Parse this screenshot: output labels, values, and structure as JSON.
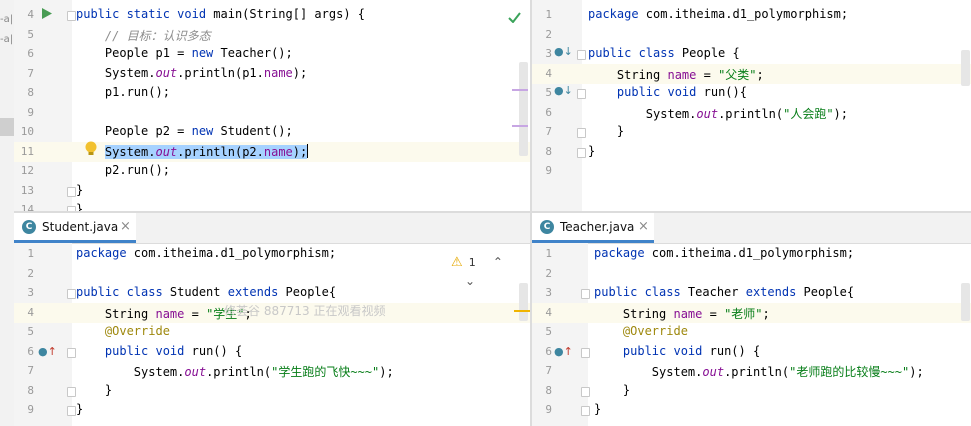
{
  "colors": {
    "keyword": "#0033b3",
    "string": "#067d17",
    "field": "#871094",
    "comment": "#8c8c8c",
    "annotation": "#9e880d",
    "selection": "#a6d2ff",
    "tab_underline": "#4083c9"
  },
  "left_strip": {
    "frag1": "-a|",
    "frag2": "-a|"
  },
  "top_left": {
    "lines": [
      {
        "n": "4",
        "html": "<span class='kw'>public static void</span> main(String[] args) {"
      },
      {
        "n": "5",
        "html": "    <span class='cmt'>// 目标：认识多态</span>"
      },
      {
        "n": "6",
        "html": "    People p1 = <span class='kw'>new</span> Teacher();"
      },
      {
        "n": "7",
        "html": "    System.<span class='it'>out</span>.println(p1.<span class='fld'>name</span>);"
      },
      {
        "n": "8",
        "html": "    p1.run();"
      },
      {
        "n": "9",
        "html": ""
      },
      {
        "n": "10",
        "html": "    People p2 = <span class='kw'>new</span> Student();"
      },
      {
        "n": "11",
        "html": "    <span class='selbg'>System.<span class='it'>out</span>.println(p2.<span class='fld'>name</span>);</span><span class='caret'></span>"
      },
      {
        "n": "12",
        "html": "    p2.run();"
      },
      {
        "n": "13",
        "html": "}"
      },
      {
        "n": "14",
        "html": "}"
      }
    ]
  },
  "top_right": {
    "lines": [
      {
        "n": "1",
        "html": "<span class='kw'>package</span> com.itheima.d1_polymorphism;"
      },
      {
        "n": "2",
        "html": ""
      },
      {
        "n": "3",
        "html": "<span class='kw'>public class</span> People {"
      },
      {
        "n": "4",
        "html": "    String <span class='fld'>name</span> = <span class='str'>\"父类\"</span>;"
      },
      {
        "n": "5",
        "html": "    <span class='kw'>public void</span> run(){"
      },
      {
        "n": "6",
        "html": "        System.<span class='it'>out</span>.println(<span class='str'>\"人会跑\"</span>);"
      },
      {
        "n": "7",
        "html": "    }"
      },
      {
        "n": "8",
        "html": "}"
      },
      {
        "n": "9",
        "html": ""
      }
    ]
  },
  "bottom_left": {
    "tab": {
      "icon": "C",
      "label": "Student.java",
      "close": "×"
    },
    "warnings": {
      "icon": "⚠",
      "count": "1",
      "up": "⌃",
      "down": "⌄"
    },
    "watermark": "修荟谷 887713 正在观看视频",
    "lines": [
      {
        "n": "1",
        "html": "<span class='kw'>package</span> com.itheima.d1_polymorphism;"
      },
      {
        "n": "2",
        "html": ""
      },
      {
        "n": "3",
        "html": "<span class='kw'>public class</span> Student <span class='kw'>extends</span> People{"
      },
      {
        "n": "4",
        "html": "    String <span class='fld'>name</span> = <span class='str'>\"学生\"</span>;"
      },
      {
        "n": "5",
        "html": "    <span class='ann'>@Override</span>"
      },
      {
        "n": "6",
        "html": "    <span class='kw'>public void</span> run() {"
      },
      {
        "n": "7",
        "html": "        System.<span class='it'>out</span>.println(<span class='str'>\"学生跑的飞快~~~\"</span>);"
      },
      {
        "n": "8",
        "html": "    }"
      },
      {
        "n": "9",
        "html": "}"
      }
    ]
  },
  "bottom_right": {
    "tab": {
      "icon": "C",
      "label": "Teacher.java",
      "close": "×"
    },
    "lines": [
      {
        "n": "1",
        "html": "<span class='kw'>package</span> com.itheima.d1_polymorphism;"
      },
      {
        "n": "2",
        "html": ""
      },
      {
        "n": "3",
        "html": "<span class='kw'>public class</span> Teacher <span class='kw'>extends</span> People{"
      },
      {
        "n": "4",
        "html": "    String <span class='fld'>name</span> = <span class='str'>\"老师\"</span>;"
      },
      {
        "n": "5",
        "html": "    <span class='ann'>@Override</span>"
      },
      {
        "n": "6",
        "html": "    <span class='kw'>public void</span> run() {"
      },
      {
        "n": "7",
        "html": "        System.<span class='it'>out</span>.println(<span class='str'>\"老师跑的比较慢~~~\"</span>);"
      },
      {
        "n": "8",
        "html": "    }"
      },
      {
        "n": "9",
        "html": "}"
      }
    ]
  }
}
